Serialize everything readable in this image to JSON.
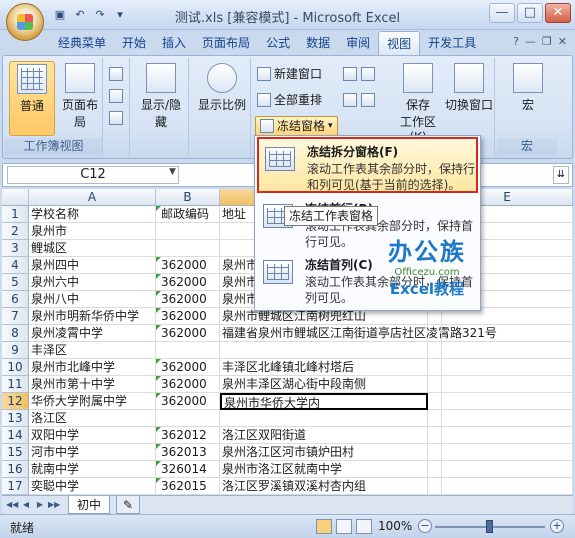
{
  "window": {
    "title": "测试.xls  [兼容模式] - Microsoft Excel",
    "controls": [
      "—",
      "□",
      "✕"
    ]
  },
  "qat": {
    "icons": [
      "save-icon",
      "undo-icon",
      "redo-icon",
      "customize-icon"
    ]
  },
  "tabs": [
    "经典菜单",
    "开始",
    "插入",
    "页面布局",
    "公式",
    "数据",
    "审阅",
    "视图",
    "开发工具"
  ],
  "active_tab": "视图",
  "ribbon": {
    "workbook_views": {
      "label": "工作簿视图",
      "normal": "普通",
      "page_layout": "页面布局"
    },
    "show_hide": "显示/隐藏",
    "zoom": "显示比例",
    "window": {
      "new_window": "新建窗口",
      "arrange_all": "全部重排",
      "freeze_panes": "冻结窗格",
      "save_workspace_line1": "保存",
      "save_workspace_line2": "工作区(K)",
      "switch_windows": "切换窗口"
    },
    "macros": {
      "button": "宏",
      "label": "宏"
    }
  },
  "formula_bar": {
    "name_box": "C12"
  },
  "columns": [
    "A",
    "B",
    "C",
    "D",
    "E"
  ],
  "rows": [
    {
      "n": "1",
      "a": "学校名称",
      "b": "邮政编码",
      "c": "地址"
    },
    {
      "n": "2",
      "a": "泉州市",
      "b": "",
      "c": ""
    },
    {
      "n": "3",
      "a": "鲤城区",
      "b": "",
      "c": ""
    },
    {
      "n": "4",
      "a": "泉州四中",
      "b": "362000",
      "c": "泉州市"
    },
    {
      "n": "5",
      "a": "泉州六中",
      "b": "362000",
      "c": "泉州市"
    },
    {
      "n": "6",
      "a": "泉州八中",
      "b": "362000",
      "c": "泉州市鲤"
    },
    {
      "n": "7",
      "a": "泉州市明新华侨中学",
      "b": "362000",
      "c": "泉州市鲤城区江南树兜红山"
    },
    {
      "n": "8",
      "a": "泉州凌霄中学",
      "b": "362000",
      "c": "福建省泉州市鲤城区江南街道亭店社区凌霄路321号"
    },
    {
      "n": "9",
      "a": "丰泽区",
      "b": "",
      "c": ""
    },
    {
      "n": "10",
      "a": "泉州市北峰中学",
      "b": "362000",
      "c": "丰泽区北峰镇北峰村塔后"
    },
    {
      "n": "11",
      "a": "泉州市第十中学",
      "b": "362000",
      "c": "泉州丰泽区湖心街中段南侧"
    },
    {
      "n": "12",
      "a": "华侨大学附属中学",
      "b": "362000",
      "c": "泉州市华侨大学内"
    },
    {
      "n": "13",
      "a": "洛江区",
      "b": "",
      "c": ""
    },
    {
      "n": "14",
      "a": "双阳中学",
      "b": "362012",
      "c": "洛江区双阳街道"
    },
    {
      "n": "15",
      "a": "河市中学",
      "b": "362013",
      "c": "泉州洛江区河市镇炉田村"
    },
    {
      "n": "16",
      "a": "就南中学",
      "b": "326014",
      "c": "泉州市洛江区就南中学"
    },
    {
      "n": "17",
      "a": "奕聪中学",
      "b": "362015",
      "c": "洛江区罗溪镇双溪村杏内组"
    }
  ],
  "freeze_menu": {
    "items": [
      {
        "title": "冻结拆分窗格(F)",
        "desc": "滚动工作表其余部分时，保持行和列可见(基于当前的选择)。"
      },
      {
        "title": "冻结首行(R)",
        "desc": "滚动工作表其余部分时，保持首行可见。"
      },
      {
        "title": "冻结首列(C)",
        "desc": "滚动工作表其余部分时，保持首列可见。"
      }
    ],
    "tooltip": "冻结工作表窗格"
  },
  "watermark": {
    "main": "办公族",
    "url": "Officezu.com",
    "sub": "Excel教程"
  },
  "sheet_tabs": [
    "初中"
  ],
  "status": {
    "ready": "就绪",
    "zoom": "100%",
    "zoom_level_percent": 100
  }
}
